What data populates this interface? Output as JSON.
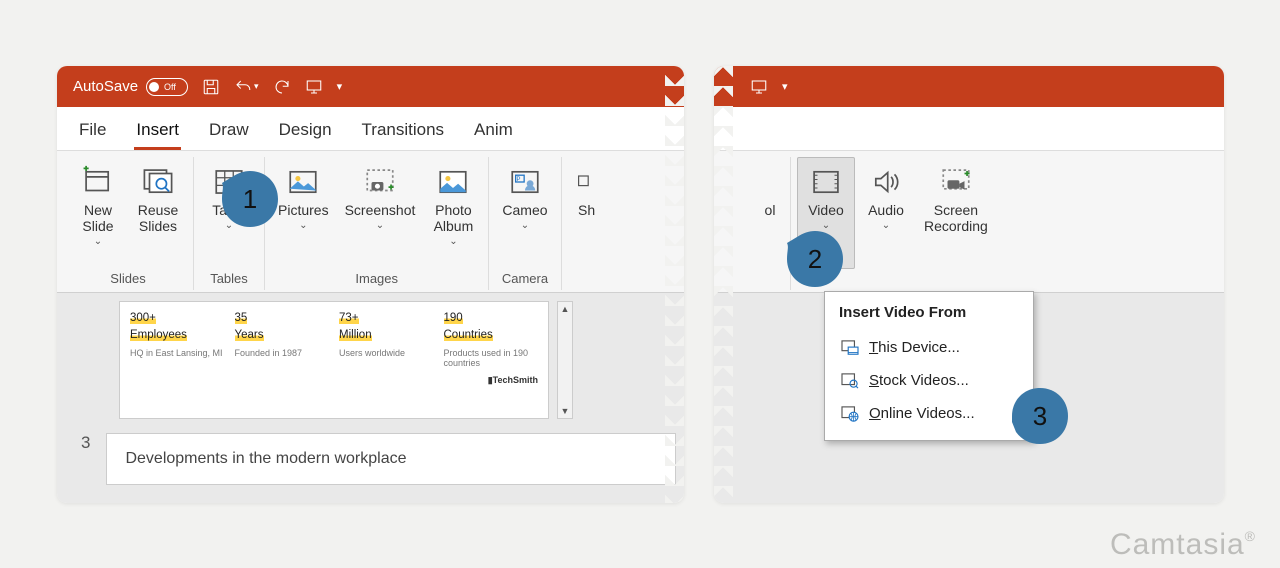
{
  "titlebar": {
    "autosave_label": "AutoSave",
    "autosave_state": "Off"
  },
  "tabs": {
    "file": "File",
    "insert": "Insert",
    "draw": "Draw",
    "design": "Design",
    "transitions": "Transitions",
    "animations": "Anim"
  },
  "ribbon_left": {
    "slides_group": "Slides",
    "tables_group": "Tables",
    "images_group": "Images",
    "camera_group": "Camera",
    "new_slide": "New\nSlide",
    "reuse_slides": "Reuse\nSlides",
    "table": "Table",
    "pictures": "Pictures",
    "screenshot": "Screenshot",
    "photo_album": "Photo\nAlbum",
    "cameo": "Cameo",
    "shapes": "Sh"
  },
  "ribbon_right": {
    "ol": "ol",
    "video": "Video",
    "audio": "Audio",
    "screen_recording": "Screen\nRecording"
  },
  "dropdown": {
    "header": "Insert Video From",
    "this_device": "This Device...",
    "stock_videos": "Stock Videos...",
    "online_videos": "Online Videos..."
  },
  "slide": {
    "stats": [
      {
        "top": "300+",
        "mid": "Employees",
        "sub": "HQ in East Lansing, MI"
      },
      {
        "top": "35",
        "mid": "Years",
        "sub": "Founded in 1987"
      },
      {
        "top": "73+",
        "mid": "Million",
        "sub": "Users worldwide"
      },
      {
        "top": "190",
        "mid": "Countries",
        "sub": "Products used in 190 countries"
      }
    ],
    "brand": "▮TechSmith",
    "next_index": "3",
    "next_title": "Developments in the modern workplace"
  },
  "badges": {
    "b1": "1",
    "b2": "2",
    "b3": "3"
  },
  "watermark": "Camtasia"
}
